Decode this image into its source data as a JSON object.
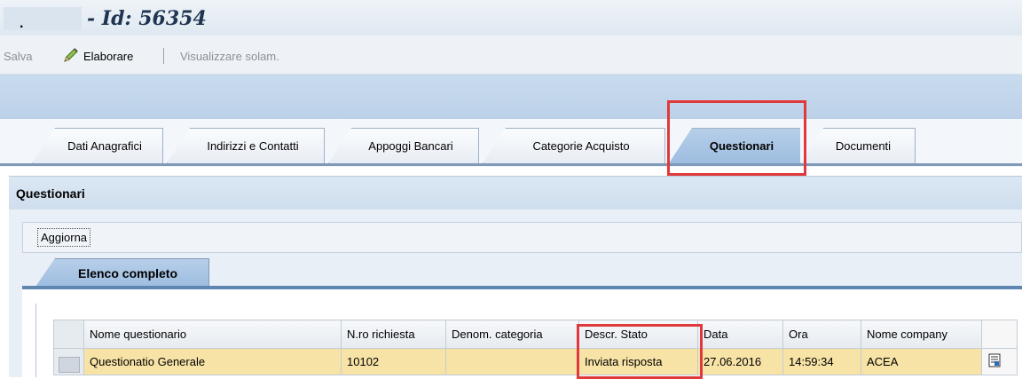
{
  "window": {
    "title": "- Id: 56354",
    "title_prefix": "."
  },
  "toolbar": {
    "save_label": "Salva",
    "edit_label": "Elaborare",
    "view_label": "Visualizzare solam."
  },
  "tabs": [
    {
      "label": "Dati Anagrafici"
    },
    {
      "label": "Indirizzi e Contatti"
    },
    {
      "label": "Appoggi Bancari"
    },
    {
      "label": "Categorie Acquisto"
    },
    {
      "label": "Questionari",
      "active": true
    },
    {
      "label": "Documenti"
    }
  ],
  "panel": {
    "title": "Questionari",
    "refresh_label": "Aggiorna",
    "subtab_label": "Elenco completo"
  },
  "table": {
    "columns": [
      "Nome questionario",
      "N.ro richiesta",
      "Denom. categoria",
      "Descr. Stato",
      "Data",
      "Ora",
      "Nome company"
    ],
    "rows": [
      [
        "Questionatio Generale",
        "10102",
        "",
        "Inviata risposta",
        "27.06.2016",
        "14:59:34",
        "ACEA"
      ]
    ]
  },
  "colors": {
    "highlight": "#e0393c",
    "selected_row": "#f7e3a6",
    "active_tab": "#9dbde0"
  },
  "icons": {
    "edit": "pencil-icon",
    "row_detail": "document-detail-icon"
  }
}
